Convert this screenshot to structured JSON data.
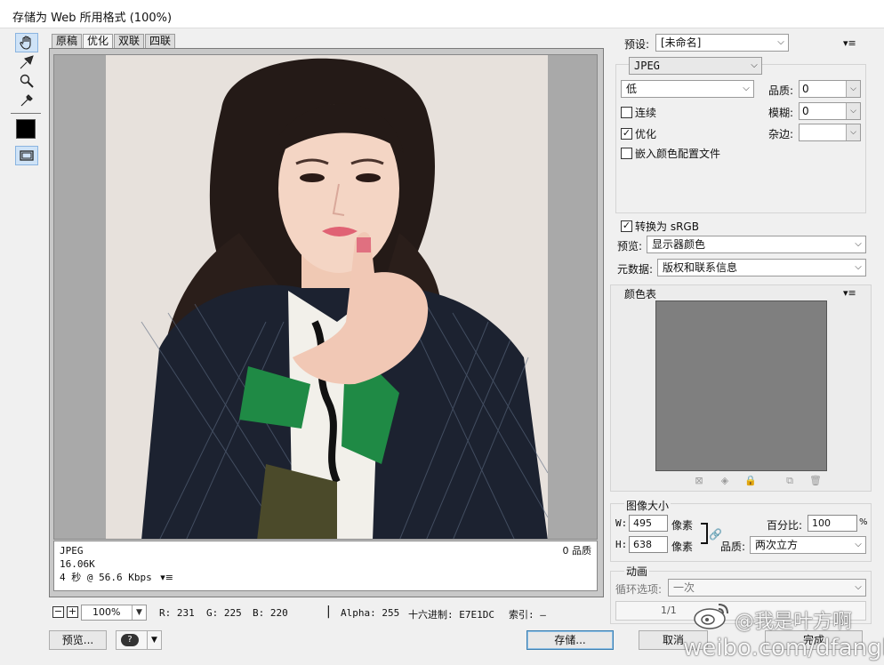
{
  "window": {
    "title": "存储为 Web 所用格式 (100%)"
  },
  "toolbar": {
    "tools": [
      "hand-tool",
      "slice-select-tool",
      "zoom-tool",
      "eyedropper-tool"
    ],
    "eyedropper_color": "#000000"
  },
  "tabs": [
    {
      "label": "原稿",
      "active": false
    },
    {
      "label": "优化",
      "active": true
    },
    {
      "label": "双联",
      "active": false
    },
    {
      "label": "四联",
      "active": false
    }
  ],
  "preview": {
    "background_color": "#E7E1DC",
    "info": {
      "format": "JPEG",
      "size": "16.06K",
      "speed": "4 秒 @ 56.6 Kbps",
      "quality": "0 品质"
    }
  },
  "statusbar": {
    "zoom_minus": "−",
    "zoom_plus": "+",
    "zoom": "100%",
    "r": "R: 231",
    "g": "G: 225",
    "b": "B: 220",
    "alpha": "Alpha: 255",
    "hex": "十六进制: E7E1DC",
    "index": "索引: —"
  },
  "buttons": {
    "preview": "预览...",
    "save": "存储...",
    "cancel": "取消",
    "done": "完成"
  },
  "settings": {
    "preset_label": "预设:",
    "preset_value": "[未命名]",
    "format": "JPEG",
    "compression": "低",
    "quality_label": "品质:",
    "quality_value": "0",
    "blur_label": "模糊:",
    "blur_value": "0",
    "matte_label": "杂边:",
    "matte_value": "",
    "progressive_label": "连续",
    "progressive_checked": false,
    "optimized_label": "优化",
    "optimized_checked": true,
    "embed_profile_label": "嵌入颜色配置文件",
    "embed_profile_checked": false,
    "srgb_label": "转换为 sRGB",
    "srgb_checked": true,
    "preview_label": "预览:",
    "preview_value": "显示器颜色",
    "metadata_label": "元数据:",
    "metadata_value": "版权和联系信息"
  },
  "color_table": {
    "title": "颜色表"
  },
  "image_size": {
    "title": "图像大小",
    "w_label": "W:",
    "w_value": "495",
    "h_label": "H:",
    "h_value": "638",
    "unit": "像素",
    "percent_label": "百分比:",
    "percent_value": "100",
    "percent_sign": "%",
    "quality_label": "品质:",
    "quality_value": "两次立方"
  },
  "animation": {
    "title": "动画",
    "loop_label": "循环选项:",
    "loop_value": "一次",
    "frame": "1/1"
  },
  "watermark": {
    "line1": "@我是叶方啊",
    "line2": "weibo.com/dfangla"
  }
}
